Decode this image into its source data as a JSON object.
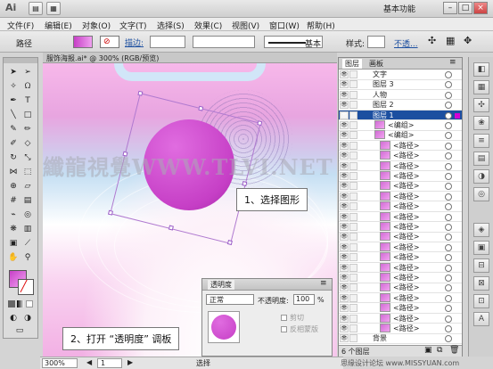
{
  "app": {
    "logo": "Ai",
    "workspace_label": "基本功能",
    "window_buttons": [
      "–",
      "□",
      "×"
    ],
    "toolbar_icons": [
      "▤",
      "▦"
    ]
  },
  "menu": [
    "文件(F)",
    "编辑(E)",
    "对象(O)",
    "文字(T)",
    "选择(S)",
    "效果(C)",
    "视图(V)",
    "窗口(W)",
    "帮助(H)"
  ],
  "control": {
    "selection_label": "路径",
    "stroke_label": "描边:",
    "stroke_style": "基本",
    "style_label": "样式:",
    "opacity_label": "不透..."
  },
  "document": {
    "tab_title": "服饰海报.ai* @ 300% (RGB/预览)",
    "zoom": "300%",
    "page": "1",
    "status": "选择"
  },
  "watermark": "纖龍視覺WWW.TLVI.NET",
  "callouts": {
    "step1": "1、选择图形",
    "step2": "2、打开 “透明度” 调板"
  },
  "layers_panel": {
    "tabs": [
      "图层",
      "画板"
    ],
    "rows": [
      {
        "label": "文字",
        "indent": 2,
        "thumb": false,
        "highlight": false
      },
      {
        "label": "图层 3",
        "indent": 2,
        "thumb": false,
        "highlight": false
      },
      {
        "label": "人物",
        "indent": 2,
        "thumb": false,
        "highlight": false
      },
      {
        "label": "图层 2",
        "indent": 2,
        "thumb": false,
        "highlight": false
      },
      {
        "label": "图层 1",
        "indent": 2,
        "thumb": false,
        "highlight": true
      },
      {
        "label": "<编组>",
        "indent": 3,
        "thumb": true,
        "highlight": false
      },
      {
        "label": "<编组>",
        "indent": 3,
        "thumb": true,
        "highlight": false
      },
      {
        "label": "<路径>",
        "indent": 4,
        "thumb": true,
        "highlight": false
      },
      {
        "label": "<路径>",
        "indent": 4,
        "thumb": true,
        "highlight": false
      },
      {
        "label": "<路径>",
        "indent": 4,
        "thumb": true,
        "highlight": false
      },
      {
        "label": "<路径>",
        "indent": 4,
        "thumb": true,
        "highlight": false
      },
      {
        "label": "<路径>",
        "indent": 4,
        "thumb": true,
        "highlight": false
      },
      {
        "label": "<路径>",
        "indent": 4,
        "thumb": true,
        "highlight": false
      },
      {
        "label": "<路径>",
        "indent": 4,
        "thumb": true,
        "highlight": false
      },
      {
        "label": "<路径>",
        "indent": 4,
        "thumb": true,
        "highlight": false
      },
      {
        "label": "<路径>",
        "indent": 4,
        "thumb": true,
        "highlight": false
      },
      {
        "label": "<路径>",
        "indent": 4,
        "thumb": true,
        "highlight": false
      },
      {
        "label": "<路径>",
        "indent": 4,
        "thumb": true,
        "highlight": false
      },
      {
        "label": "<路径>",
        "indent": 4,
        "thumb": true,
        "highlight": false
      },
      {
        "label": "<路径>",
        "indent": 4,
        "thumb": true,
        "highlight": false
      },
      {
        "label": "<路径>",
        "indent": 4,
        "thumb": true,
        "highlight": false
      },
      {
        "label": "<路径>",
        "indent": 4,
        "thumb": true,
        "highlight": false
      },
      {
        "label": "<路径>",
        "indent": 4,
        "thumb": true,
        "highlight": false
      },
      {
        "label": "<路径>",
        "indent": 4,
        "thumb": true,
        "highlight": false
      },
      {
        "label": "<路径>",
        "indent": 4,
        "thumb": true,
        "highlight": false
      },
      {
        "label": "<路径>",
        "indent": 4,
        "thumb": true,
        "highlight": false
      },
      {
        "label": "背景",
        "indent": 2,
        "thumb": false,
        "highlight": false
      }
    ],
    "footer": "6 个图层"
  },
  "transparency_panel": {
    "title": "透明度",
    "blend_mode": "正常",
    "opacity_label": "不透明度:",
    "opacity_value": "100",
    "opacity_unit": "%",
    "clip_label": "剪切",
    "invert_label": "反相蒙版"
  },
  "credit": "思缘设计论坛 www.MISSYUAN.com",
  "colors": {
    "accent": "#c63fc6",
    "highlight_row": "#1c4fa0"
  }
}
